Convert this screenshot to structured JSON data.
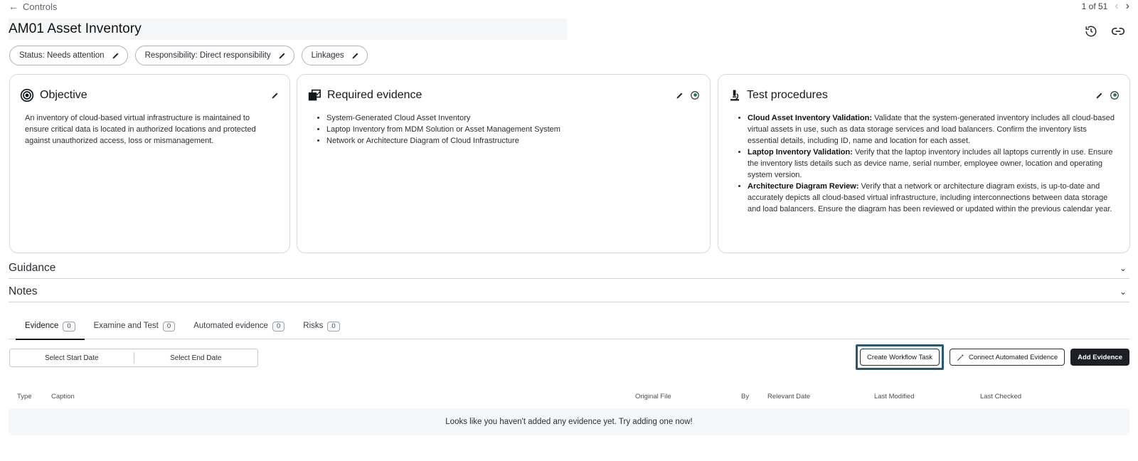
{
  "nav": {
    "back_label": "Controls",
    "pager_text": "1 of 51"
  },
  "header": {
    "title": "AM01 Asset Inventory"
  },
  "chips": [
    {
      "label": "Status: Needs attention"
    },
    {
      "label": "Responsibility: Direct responsibility"
    },
    {
      "label": "Linkages"
    }
  ],
  "cards": {
    "objective": {
      "title": "Objective",
      "text": "An inventory of cloud-based virtual infrastructure is maintained to ensure critical data is located in authorized locations and protected against unauthorized access, loss or mismanagement."
    },
    "required_evidence": {
      "title": "Required evidence",
      "items": [
        "System-Generated Cloud Asset Inventory",
        "Laptop Inventory from MDM Solution or Asset Management System",
        "Network or Architecture Diagram of Cloud Infrastructure"
      ]
    },
    "test_procedures": {
      "title": "Test procedures",
      "items": [
        {
          "bold": "Cloud Asset Inventory Validation:",
          "text": " Validate that the system-generated inventory includes all cloud-based virtual assets in use, such as data storage services and load balancers. Confirm the inventory lists essential details, including ID, name and location for each asset."
        },
        {
          "bold": "Laptop Inventory Validation:",
          "text": " Verify that the laptop inventory includes all laptops currently in use. Ensure the inventory lists details such as device name, serial number, employee owner, location and operating system version."
        },
        {
          "bold": "Architecture Diagram Review:",
          "text": " Verify that a network or architecture diagram exists, is up-to-date and accurately depicts all cloud-based virtual infrastructure, including interconnections between data storage and load balancers. Ensure the diagram has been reviewed or updated within the previous calendar year."
        }
      ]
    }
  },
  "sections": {
    "guidance": "Guidance",
    "notes": "Notes"
  },
  "tabs": [
    {
      "label": "Evidence",
      "count": "0"
    },
    {
      "label": "Examine and Test",
      "count": "0"
    },
    {
      "label": "Automated evidence",
      "count": "0"
    },
    {
      "label": "Risks",
      "count": "0"
    }
  ],
  "filters": {
    "start_date": "Select Start Date",
    "end_date": "Select End Date"
  },
  "buttons": {
    "create_workflow": "Create Workflow Task",
    "connect_automated": "Connect Automated Evidence",
    "add_evidence": "Add Evidence"
  },
  "table": {
    "columns": [
      "Type",
      "Caption",
      "Original File",
      "By",
      "Relevant Date",
      "Last Modified",
      "Last Checked"
    ],
    "empty_message": "Looks like you haven't added any evidence yet. Try adding one now!"
  },
  "colors": {
    "highlight_border": "#245a78",
    "primary_button": "#1c2026"
  }
}
